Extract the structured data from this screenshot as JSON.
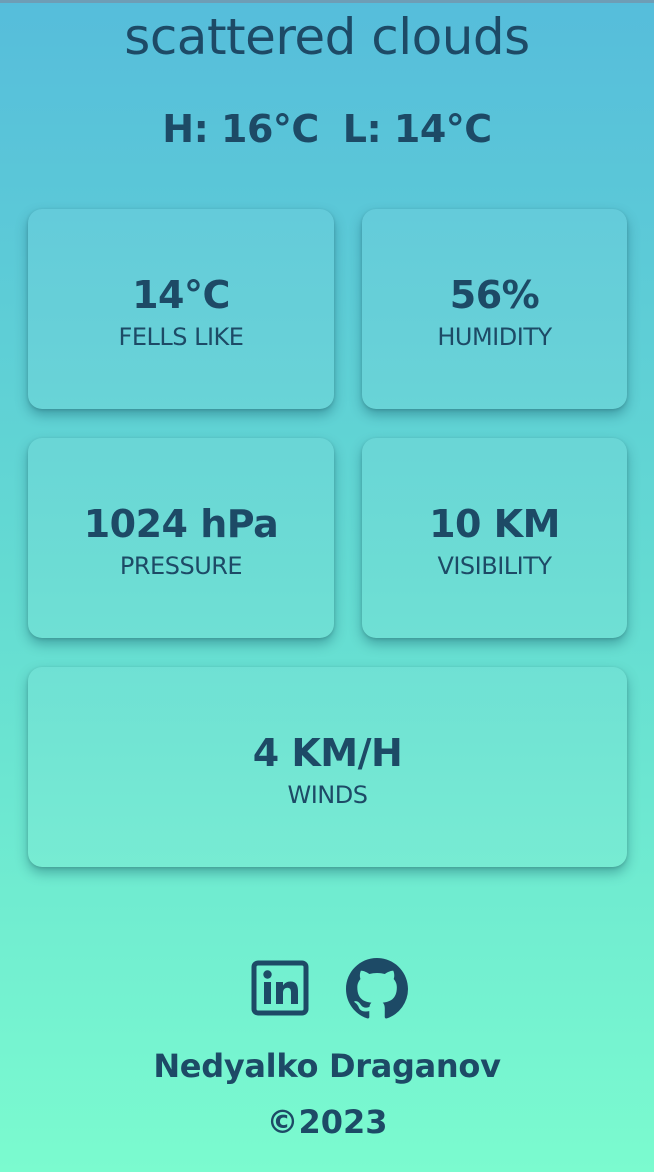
{
  "weather": {
    "condition": "scattered clouds",
    "high": "H: 16°C",
    "low": "L: 14°C"
  },
  "cards": {
    "feels_like": {
      "value": "14°C",
      "label": "FELLS LIKE"
    },
    "humidity": {
      "value": "56%",
      "label": "HUMIDITY"
    },
    "pressure": {
      "value": "1024 hPa",
      "label": "PRESSURE"
    },
    "visibility": {
      "value": "10 KM",
      "label": "VISIBILITY"
    },
    "winds": {
      "value": "4 KM/H",
      "label": "WINDS"
    }
  },
  "footer": {
    "icons": [
      "linkedin-icon",
      "github-icon"
    ],
    "author": "Nedyalko Draganov",
    "copyright": "©2023"
  },
  "colors": {
    "text": "#1d4a66",
    "gradient_top": "#56bddb",
    "gradient_bottom": "#7bfbcf"
  }
}
